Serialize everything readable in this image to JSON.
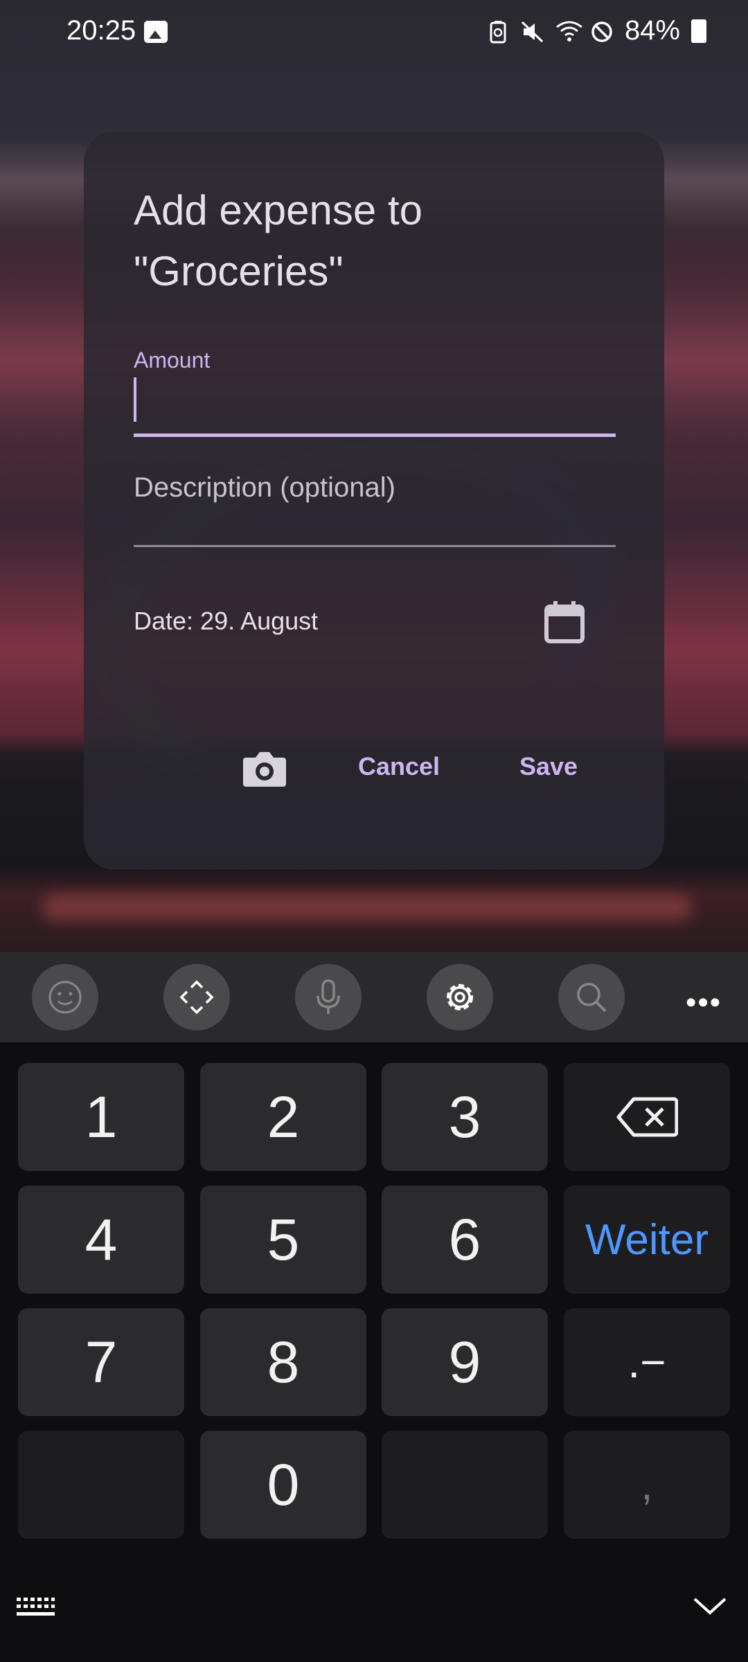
{
  "status_bar": {
    "time": "20:25",
    "battery": "84%",
    "icons": [
      "image-icon",
      "battery-saver-icon",
      "mute-icon",
      "wifi-icon",
      "do-not-disturb-icon",
      "battery-icon"
    ]
  },
  "dialog": {
    "title": "Add expense to \"Groceries\"",
    "amount": {
      "label": "Amount",
      "value": ""
    },
    "description": {
      "placeholder": "Description (optional)",
      "value": ""
    },
    "date_text": "Date: 29. August",
    "buttons": {
      "camera_icon": "camera-icon",
      "cancel": "Cancel",
      "save": "Save"
    }
  },
  "keyboard": {
    "toolbar": [
      "emoji-icon",
      "cursor-move-icon",
      "microphone-icon",
      "settings-icon",
      "search-icon",
      "more-icon"
    ],
    "more_label": "•••",
    "keys": {
      "k1": "1",
      "k2": "2",
      "k3": "3",
      "k4": "4",
      "k5": "5",
      "k6": "6",
      "k7": "7",
      "k8": "8",
      "k9": "9",
      "k0": "0",
      "next": "Weiter",
      "dot_dash": ".−",
      "comma": ","
    }
  },
  "colors": {
    "accent": "#cdb6f0",
    "keyboard_action": "#4f97ff",
    "dialog_bg": "#2a2830"
  }
}
